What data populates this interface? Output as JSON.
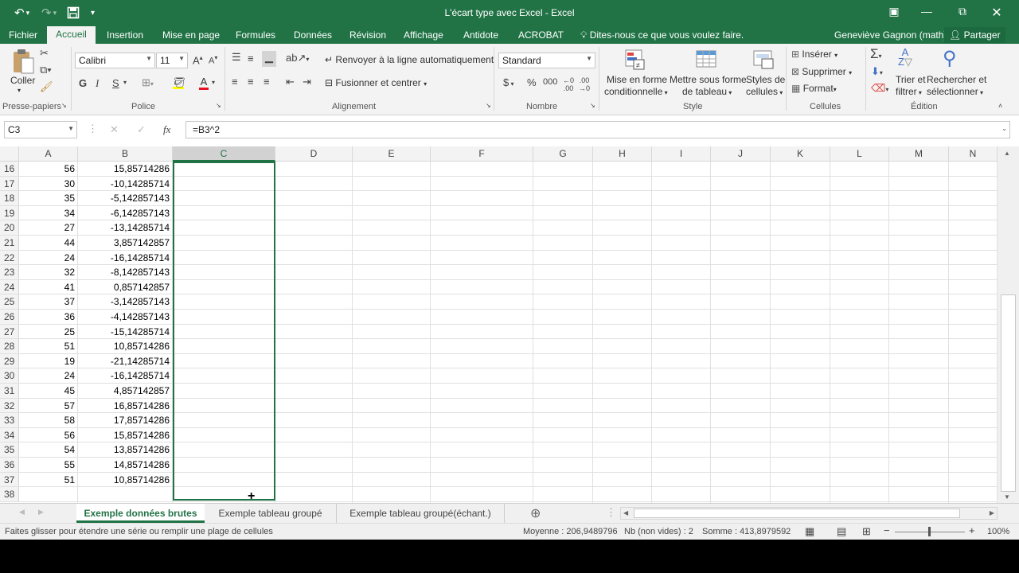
{
  "titlebar": {
    "title": "L'écart type avec Excel - Excel",
    "undo_icon": "undo-icon",
    "redo_icon": "redo-icon",
    "save_icon": "save-icon",
    "customize_icon": "customize-qat-icon",
    "window_controls": [
      "ribbon-display-icon",
      "minimize-icon",
      "restore-icon",
      "close-icon"
    ]
  },
  "menu": {
    "tabs": [
      "Fichier",
      "Accueil",
      "Insertion",
      "Mise en page",
      "Formules",
      "Données",
      "Révision",
      "Affichage",
      "Antidote",
      "ACROBAT"
    ],
    "tell_me": "Dites-nous ce que vous voulez faire.",
    "user": "Geneviève Gagnon (math)",
    "share": "Partager"
  },
  "ribbon": {
    "clipboard": {
      "paste": "Coller",
      "label": "Presse-papiers"
    },
    "font": {
      "name": "Calibri",
      "size": "11",
      "bold": "G",
      "italic": "I",
      "underline": "S",
      "label": "Police"
    },
    "alignment": {
      "wrap": "Renvoyer à la ligne automatiquement",
      "merge": "Fusionner et centrer",
      "label": "Alignement"
    },
    "number": {
      "format": "Standard",
      "currency": "$",
      "percent": "%",
      "thousands": "000",
      "label": "Nombre"
    },
    "style": {
      "conditional_1": "Mise en forme",
      "conditional_2": "conditionnelle",
      "table_1": "Mettre sous forme",
      "table_2": "de tableau",
      "cell_styles_1": "Styles de",
      "cell_styles_2": "cellules",
      "label": "Style"
    },
    "cells": {
      "insert": "Insérer",
      "delete": "Supprimer",
      "format": "Format",
      "label": "Cellules"
    },
    "editing": {
      "sort_1": "Trier et",
      "sort_2": "filtrer",
      "find_1": "Rechercher et",
      "find_2": "sélectionner",
      "label": "Édition"
    }
  },
  "formula_bar": {
    "name_box": "C3",
    "fx": "fx",
    "formula": "=B3^2"
  },
  "columns": [
    "A",
    "B",
    "C",
    "D",
    "E",
    "F",
    "G",
    "H",
    "I",
    "J",
    "K",
    "L",
    "M",
    "N"
  ],
  "selected_column": "C",
  "rows": [
    {
      "n": "16",
      "a": "56",
      "b": "15,85714286"
    },
    {
      "n": "17",
      "a": "30",
      "b": "-10,14285714"
    },
    {
      "n": "18",
      "a": "35",
      "b": "-5,142857143"
    },
    {
      "n": "19",
      "a": "34",
      "b": "-6,142857143"
    },
    {
      "n": "20",
      "a": "27",
      "b": "-13,14285714"
    },
    {
      "n": "21",
      "a": "44",
      "b": "3,857142857"
    },
    {
      "n": "22",
      "a": "24",
      "b": "-16,14285714"
    },
    {
      "n": "23",
      "a": "32",
      "b": "-8,142857143"
    },
    {
      "n": "24",
      "a": "41",
      "b": "0,857142857"
    },
    {
      "n": "25",
      "a": "37",
      "b": "-3,142857143"
    },
    {
      "n": "26",
      "a": "36",
      "b": "-4,142857143"
    },
    {
      "n": "27",
      "a": "25",
      "b": "-15,14285714"
    },
    {
      "n": "28",
      "a": "51",
      "b": "10,85714286"
    },
    {
      "n": "29",
      "a": "19",
      "b": "-21,14285714"
    },
    {
      "n": "30",
      "a": "24",
      "b": "-16,14285714"
    },
    {
      "n": "31",
      "a": "45",
      "b": "4,857142857"
    },
    {
      "n": "32",
      "a": "57",
      "b": "16,85714286"
    },
    {
      "n": "33",
      "a": "58",
      "b": "17,85714286"
    },
    {
      "n": "34",
      "a": "56",
      "b": "15,85714286"
    },
    {
      "n": "35",
      "a": "54",
      "b": "13,85714286"
    },
    {
      "n": "36",
      "a": "55",
      "b": "14,85714286"
    },
    {
      "n": "37",
      "a": "51",
      "b": "10,85714286"
    },
    {
      "n": "38",
      "a": "",
      "b": ""
    }
  ],
  "sheets": [
    "Exemple données brutes",
    "Exemple tableau groupé",
    "Exemple tableau groupé(échant.)"
  ],
  "active_sheet": "Exemple données brutes",
  "status": {
    "message": "Faites glisser pour étendre une série ou remplir une plage de cellules",
    "average": "Moyenne : 206,9489796",
    "count": "Nb (non vides) : 2",
    "sum": "Somme : 413,8979592",
    "zoom": "100%"
  },
  "colors": {
    "accent": "#217346"
  }
}
